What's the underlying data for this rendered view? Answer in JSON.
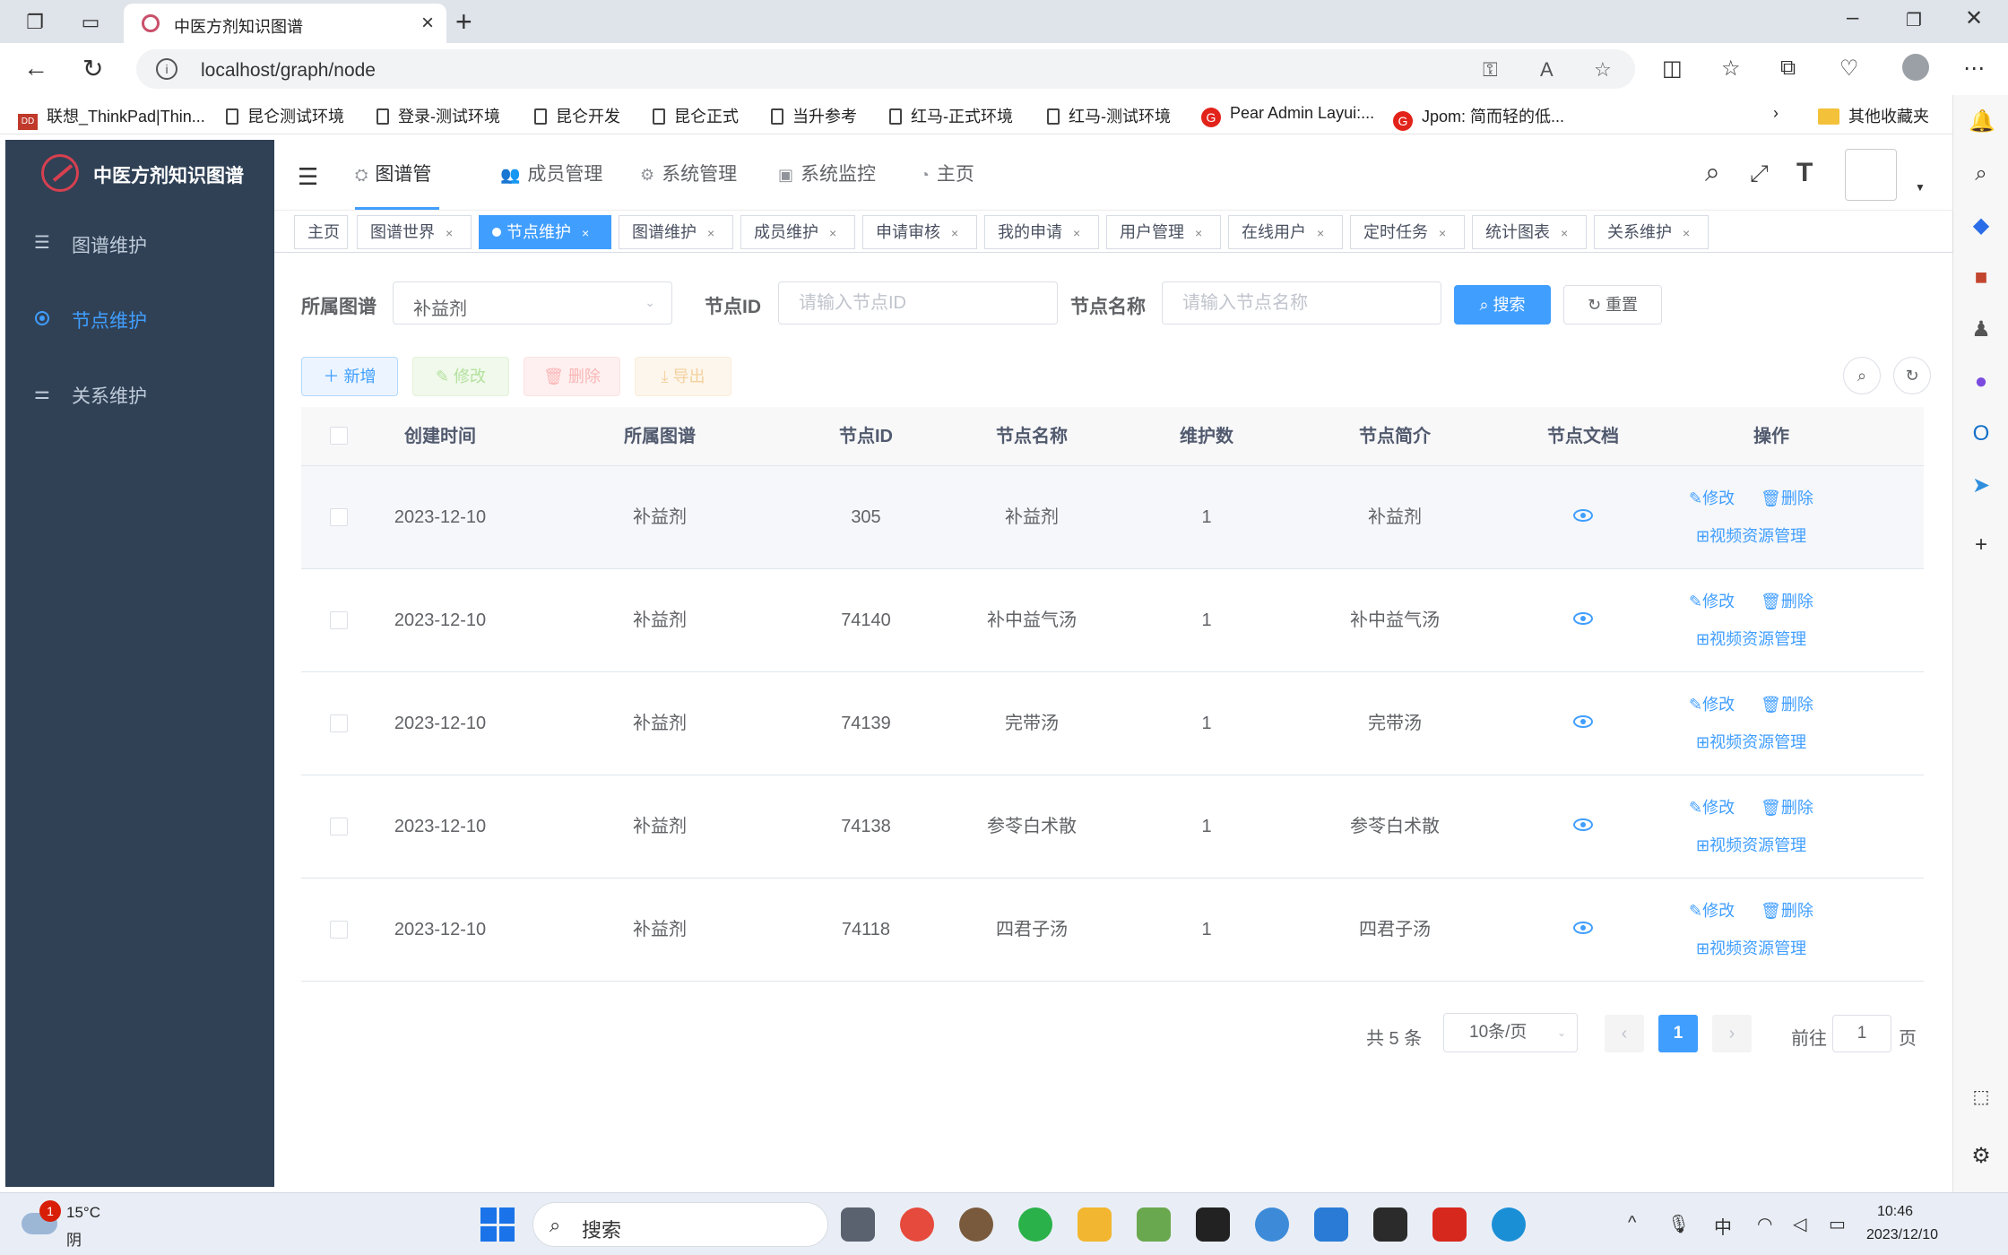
{
  "browser": {
    "tab_title": "中医方剂知识图谱",
    "url": "localhost/graph/node",
    "bookmarks": [
      "联想_ThinkPad|Thin...",
      "昆仑测试环境",
      "登录-测试环境",
      "昆仑开发",
      "昆仑正式",
      "当升参考",
      "红马-正式环境",
      "红马-测试环境",
      "Pear Admin Layui:...",
      "Jpom: 简而轻的低...",
      "其他收藏夹"
    ]
  },
  "app": {
    "title": "中医方剂知识图谱",
    "sidebar": [
      {
        "label": "图谱维护",
        "icon": "list-icon"
      },
      {
        "label": "节点维护",
        "icon": "radio-dot-icon",
        "active": true
      },
      {
        "label": "关系维护",
        "icon": "sliders-icon"
      }
    ],
    "topnav": [
      {
        "label": "图谱管理",
        "icon": "sitemap-icon",
        "active": true
      },
      {
        "label": "成员管理",
        "icon": "users-icon"
      },
      {
        "label": "系统管理",
        "icon": "gear-icon"
      },
      {
        "label": "系统监控",
        "icon": "monitor-icon"
      },
      {
        "label": "主页",
        "icon": "dashboard-icon"
      }
    ],
    "tags": [
      "主页",
      "图谱世界",
      "节点维护",
      "图谱维护",
      "成员维护",
      "申请审核",
      "我的申请",
      "用户管理",
      "在线用户",
      "定时任务",
      "统计图表",
      "关系维护"
    ],
    "active_tag": "节点维护"
  },
  "filters": {
    "graph_label": "所属图谱",
    "graph_value": "补益剂",
    "node_id_label": "节点ID",
    "node_id_placeholder": "请输入节点ID",
    "node_name_label": "节点名称",
    "node_name_placeholder": "请输入节点名称",
    "search_btn": "搜索",
    "reset_btn": "重置"
  },
  "toolbar": {
    "add": "新增",
    "edit": "修改",
    "delete": "删除",
    "export": "导出"
  },
  "table": {
    "headers": [
      "创建时间",
      "所属图谱",
      "节点ID",
      "节点名称",
      "维护数",
      "节点简介",
      "节点文档",
      "操作"
    ],
    "rows": [
      {
        "created": "2023-12-10",
        "graph": "补益剂",
        "id": "305",
        "name": "补益剂",
        "count": "1",
        "intro": "补益剂"
      },
      {
        "created": "2023-12-10",
        "graph": "补益剂",
        "id": "74140",
        "name": "补中益气汤",
        "count": "1",
        "intro": "补中益气汤"
      },
      {
        "created": "2023-12-10",
        "graph": "补益剂",
        "id": "74139",
        "name": "完带汤",
        "count": "1",
        "intro": "完带汤"
      },
      {
        "created": "2023-12-10",
        "graph": "补益剂",
        "id": "74138",
        "name": "参苓白术散",
        "count": "1",
        "intro": "参苓白术散"
      },
      {
        "created": "2023-12-10",
        "graph": "补益剂",
        "id": "74118",
        "name": "四君子汤",
        "count": "1",
        "intro": "四君子汤"
      }
    ],
    "op_edit": "修改",
    "op_delete": "删除",
    "op_video": "视频资源管理"
  },
  "pagination": {
    "total": "共 5 条",
    "page_size": "10条/页",
    "current": "1",
    "goto_prefix": "前往",
    "goto_value": "1",
    "goto_suffix": "页"
  },
  "taskbar": {
    "temp": "15°C",
    "weather": "阴",
    "badge": "1",
    "search": "搜索",
    "ime": "中",
    "time": "10:46",
    "date": "2023/12/10"
  },
  "colors": {
    "primary": "#409eff",
    "sidebar_bg": "#304156"
  }
}
